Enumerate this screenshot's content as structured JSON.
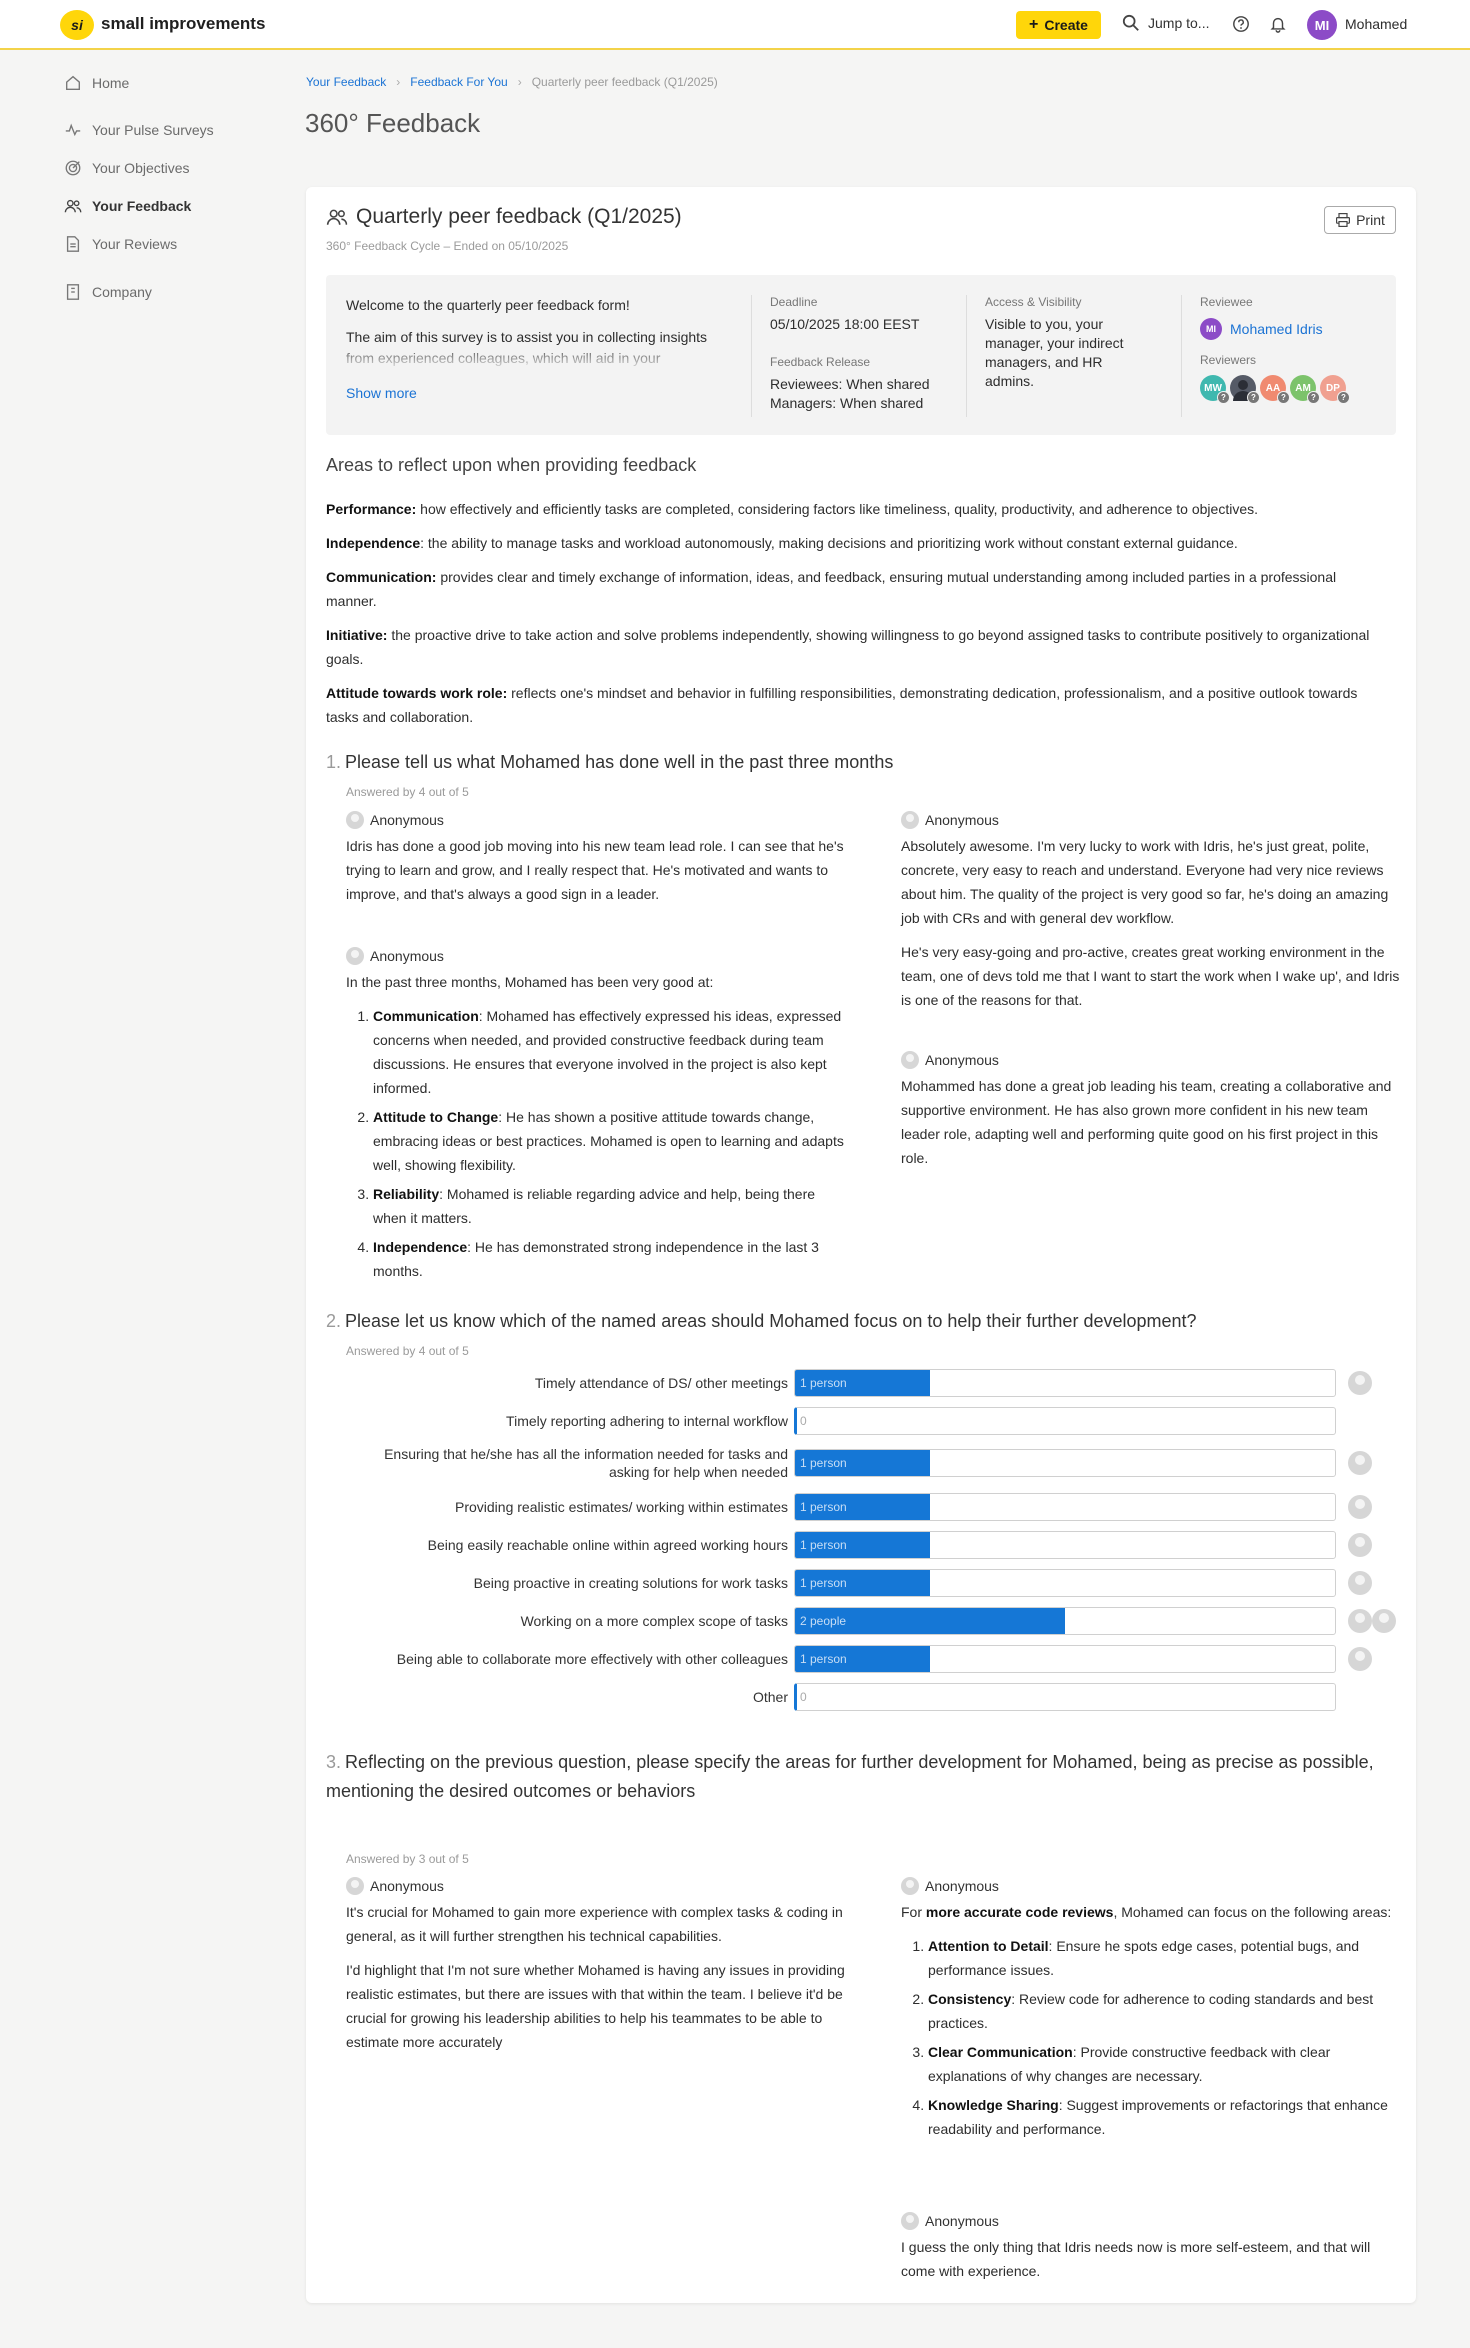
{
  "app": {
    "logo_mark": "si",
    "logo_text": "small improvements"
  },
  "topbar": {
    "create_label": "Create",
    "jump_label": "Jump to...",
    "user_initials": "MI",
    "user_name": "Mohamed"
  },
  "sidebar": {
    "items": [
      {
        "label": "Home",
        "icon": "home-icon"
      },
      {
        "label": "Your Pulse Surveys",
        "icon": "pulse-icon"
      },
      {
        "label": "Your Objectives",
        "icon": "target-icon"
      },
      {
        "label": "Your Feedback",
        "icon": "people-icon",
        "active": true
      },
      {
        "label": "Your Reviews",
        "icon": "document-icon"
      },
      {
        "label": "Company",
        "icon": "building-icon"
      }
    ]
  },
  "breadcrumb": {
    "items": [
      "Your Feedback",
      "Feedback For You"
    ],
    "current": "Quarterly peer feedback (Q1/2025)"
  },
  "page": {
    "title": "360° Feedback"
  },
  "card": {
    "title": "Quarterly peer feedback (Q1/2025)",
    "subtitle": "360° Feedback Cycle – Ended on 05/10/2025",
    "print_label": "Print",
    "intro": {
      "welcome": "Welcome to the quarterly peer feedback form!",
      "aim": "The aim of this survey is to assist you in collecting insights from experienced colleagues, which will aid in your",
      "show_more": "Show more"
    },
    "deadline_label": "Deadline",
    "deadline_value": "05/10/2025 18:00 EEST",
    "release_label": "Feedback Release",
    "release_reviewees": "Reviewees: When shared",
    "release_managers": "Managers: When shared",
    "access_label": "Access & Visibility",
    "access_value": "Visible to you, your manager, your indirect managers, and HR admins.",
    "reviewee_label": "Reviewee",
    "reviewee_initials": "MI",
    "reviewee_name": "Mohamed Idris",
    "reviewers_label": "Reviewers",
    "reviewers": [
      {
        "initials": "MW",
        "color": "#3fb8af"
      },
      {
        "initials": "",
        "color": "#555a66"
      },
      {
        "initials": "AA",
        "color": "#f08a70"
      },
      {
        "initials": "AM",
        "color": "#7cc36b"
      },
      {
        "initials": "DP",
        "color": "#f0a090"
      }
    ],
    "reviewer_badge": "?"
  },
  "areas": {
    "title": "Areas to reflect upon when providing feedback",
    "items": [
      {
        "term": "Performance:",
        "text": " how effectively and efficiently tasks are completed, considering factors like timeliness, quality, productivity, and adherence to objectives."
      },
      {
        "term": "Independence",
        "text": ": the ability to manage tasks and workload autonomously, making decisions and prioritizing work without constant external guidance."
      },
      {
        "term": "Communication:",
        "text": " provides clear and timely exchange of information, ideas, and feedback, ensuring mutual understanding among included parties in a professional manner."
      },
      {
        "term": "Initiative:",
        "text": " the proactive drive to take action and solve problems independently, showing willingness to go beyond assigned tasks to contribute positively to organizational goals."
      },
      {
        "term": "Attitude towards work role:",
        "text": " reflects one's mindset and behavior in fulfilling responsibilities, demonstrating dedication, professionalism, and a positive outlook towards tasks and collaboration."
      }
    ]
  },
  "anonymous_label": "Anonymous",
  "q1": {
    "num": "1.",
    "text": "Please tell us what Mohamed has done well in the past three months",
    "answered": "Answered by 4 out of 5",
    "a1": "Idris has done a good job moving into his new team lead role. I can see that he's trying to learn and grow, and I really respect that. He's motivated and wants to improve, and that's always a good sign in a leader.",
    "a2_intro": "In the past three months, Mohamed has been very good at:",
    "a2_items": [
      {
        "term": "Communication",
        "text": ": Mohamed has effectively expressed his ideas, expressed concerns when needed, and provided constructive feedback during team discussions. He ensures that everyone involved in the project is also kept informed."
      },
      {
        "term": "Attitude to Change",
        "text": ": He has shown a positive attitude towards change, embracing ideas or best practices. Mohamed is open to learning and adapts well, showing flexibility."
      },
      {
        "term": "Reliability",
        "text": ": Mohamed is reliable regarding advice and help, being there when it matters."
      },
      {
        "term": "Independence",
        "text": ": He has demonstrated strong independence in the last 3 months."
      }
    ],
    "a3_p1": "Absolutely awesome. I'm very lucky to work with Idris, he's just great, polite, concrete, very easy to reach and understand. Everyone had very nice reviews about him. The quality of the project is very good so far, he's doing an amazing job with CRs and with general dev workflow.",
    "a3_p2": "He's very easy-going and pro-active, creates great working environment in the team, one of devs told me that I want to start the work when I wake up', and Idris is one of the reasons for that.",
    "a4": "Mohammed has done a great job leading his team, creating a collaborative and supportive environment. He has also grown more confident in his new team leader role, adapting well and performing quite good on his first project in this role."
  },
  "q2": {
    "num": "2.",
    "text": "Please let us know which of the named areas should Mohamed focus on to help their  further development?",
    "answered": "Answered by 4 out of 5",
    "chart_data": {
      "type": "bar",
      "orientation": "horizontal",
      "categories": [
        "Timely attendance of DS/ other meetings",
        "Timely reporting adhering to internal workflow",
        "Ensuring that he/she has all the information needed for tasks and asking for help when needed",
        "Providing realistic estimates/ working within estimates",
        "Being easily reachable online within agreed working hours",
        "Being proactive in creating solutions for work tasks",
        "Working on a more complex scope of tasks",
        "Being able to collaborate more effectively with other colleagues",
        "Other"
      ],
      "values": [
        1,
        0,
        1,
        1,
        1,
        1,
        2,
        1,
        0
      ],
      "value_labels": [
        "1 person",
        "0",
        "1 person",
        "1 person",
        "1 person",
        "1 person",
        "2 people",
        "1 person",
        "0"
      ],
      "max": 4
    }
  },
  "q3": {
    "num": "3.",
    "text": "Reflecting on the previous question, please specify the areas for further development for Mohamed, being as precise as possible, mentioning the desired outcomes or behaviors",
    "answered": "Answered by 3 out of 5",
    "a1_p1": "It's crucial for Mohamed to gain more experience with complex tasks & coding in general, as it will further strengthen his technical capabilities.",
    "a1_p2": "I'd highlight that I'm not sure whether Mohamed is having any issues in providing realistic estimates, but there are issues with that within the team. I believe it'd be crucial for growing his leadership abilities to help his teammates to be able to estimate more accurately",
    "a2_pre": "For ",
    "a2_bold": "more accurate code reviews",
    "a2_post": ", Mohamed can focus on the following areas:",
    "a2_items": [
      {
        "term": "Attention to Detail",
        "text": ": Ensure he spots edge cases, potential bugs, and performance issues."
      },
      {
        "term": "Consistency",
        "text": ": Review code for adherence to coding standards and best practices."
      },
      {
        "term": "Clear Communication",
        "text": ": Provide constructive feedback with clear explanations of why changes are necessary."
      },
      {
        "term": "Knowledge Sharing",
        "text": ": Suggest improvements or refactorings that enhance readability and performance."
      }
    ],
    "a3": "I guess the only thing that Idris needs now is more self-esteem, and that will come with experience."
  },
  "colors": {
    "accent": "#ffd60a",
    "link": "#1b73d4",
    "bar": "#1577d6",
    "avatar": "#8c4bc7"
  }
}
